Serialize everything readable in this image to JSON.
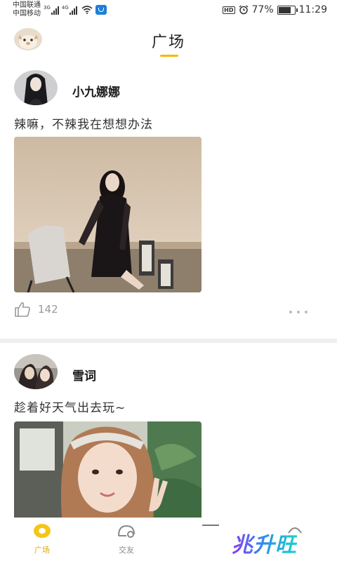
{
  "status_bar": {
    "carrier_1": "中国联通",
    "carrier_2": "中国移动",
    "network_1": "3G",
    "network_2": "4G",
    "hd_badge": "HD",
    "battery_percent": "77%",
    "battery_level": 0.77,
    "time": "11:29"
  },
  "header": {
    "title": "广场",
    "accent_color": "#f5b800"
  },
  "posts": [
    {
      "username": "小九娜娜",
      "content": "辣嘛，不辣我在想想办法",
      "like_count": "142"
    },
    {
      "username": "雪词",
      "content": "趁着好天气出去玩~"
    }
  ],
  "bottom_nav": {
    "items": [
      {
        "label": "广场",
        "icon": "square-icon",
        "active": true
      },
      {
        "label": "交友",
        "icon": "friend-icon",
        "active": false
      }
    ],
    "active_color": "#e0a800"
  },
  "watermark": "兆升旺"
}
